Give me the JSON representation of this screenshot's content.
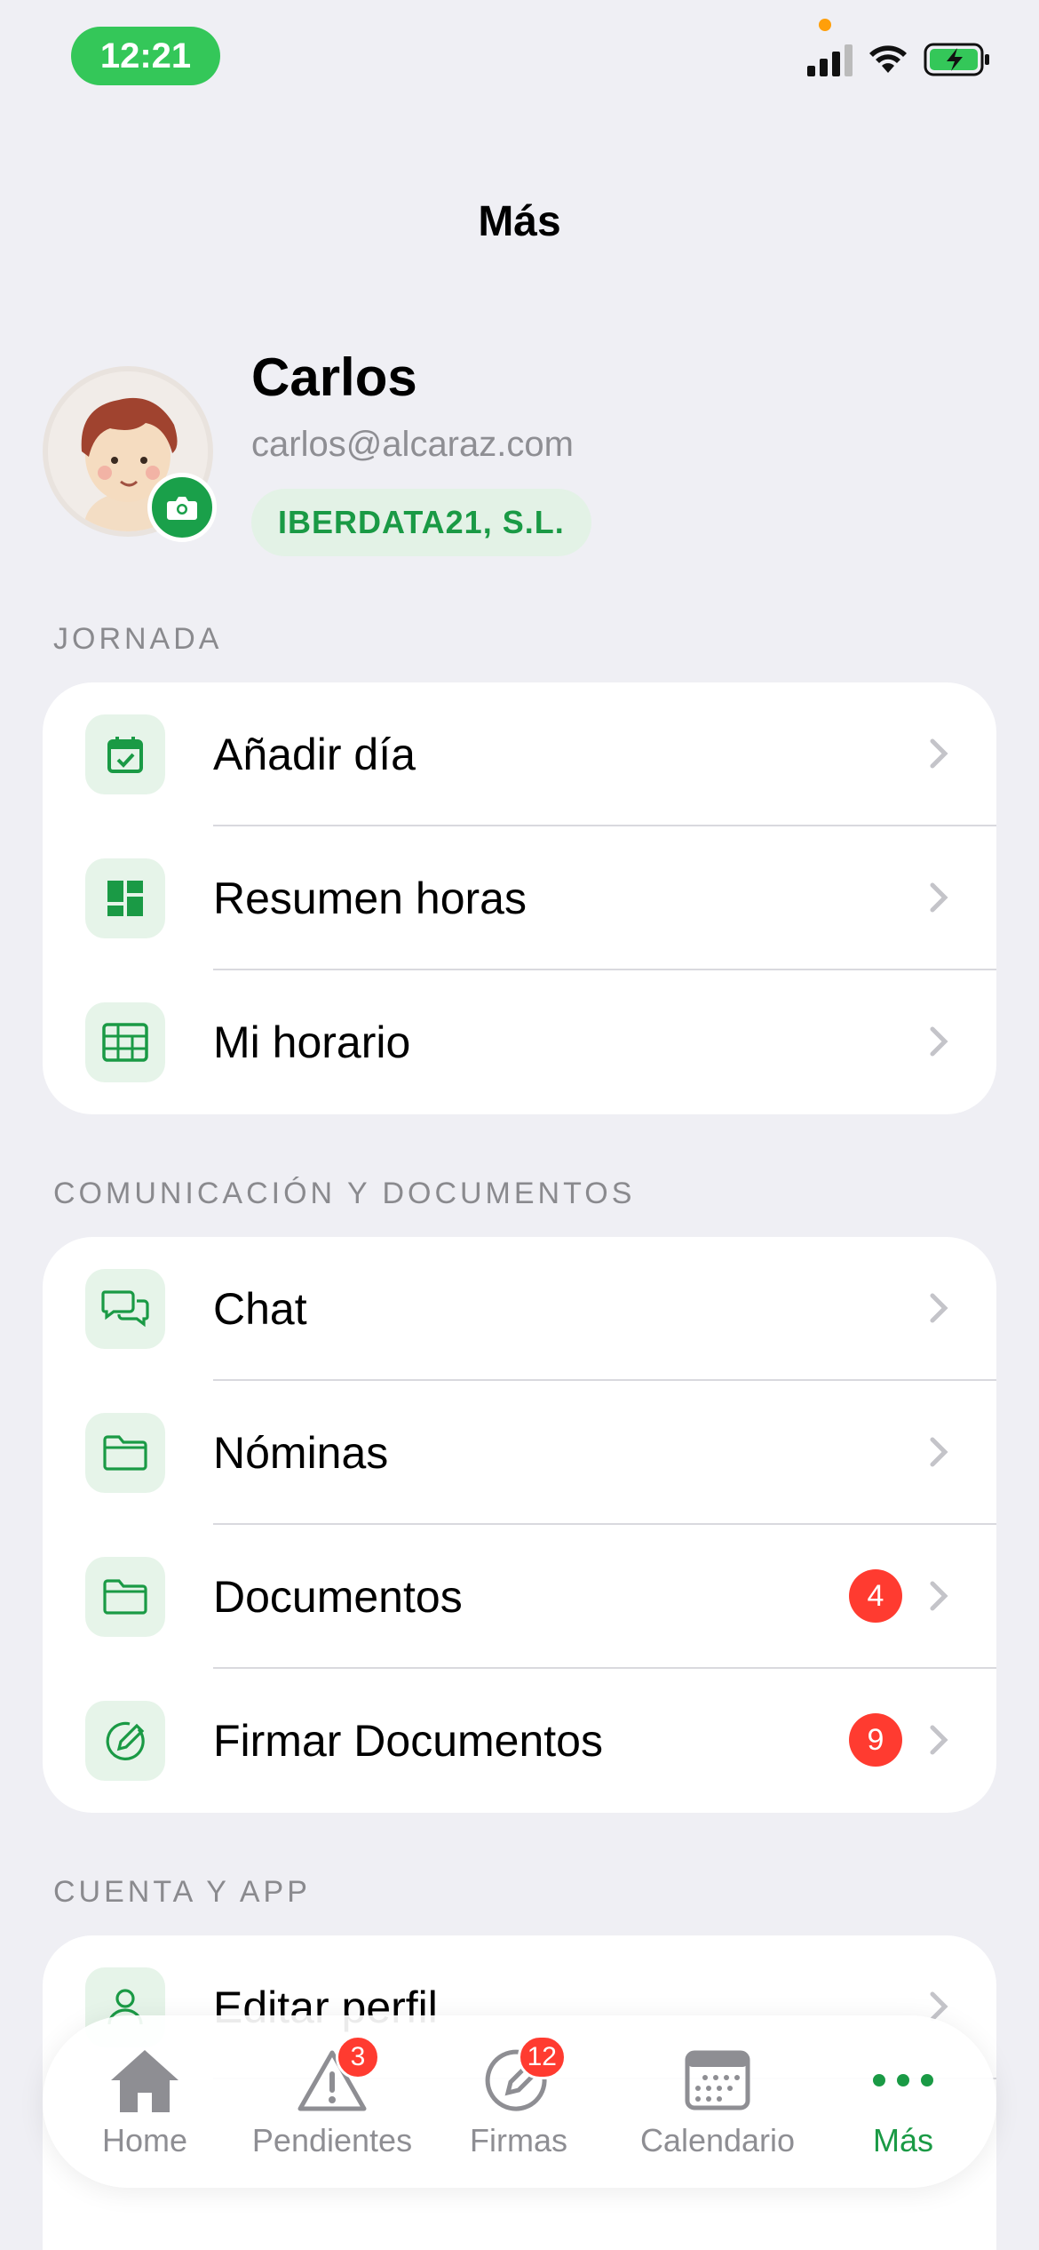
{
  "status_bar": {
    "time": "12:21"
  },
  "nav": {
    "title": "Más"
  },
  "profile": {
    "name": "Carlos",
    "email": "carlos@alcaraz.com",
    "company": "IBERDATA21, S.L."
  },
  "sections": [
    {
      "header": "JORNADA",
      "items": [
        {
          "label": "Añadir día",
          "icon": "calendar-check-icon"
        },
        {
          "label": "Resumen horas",
          "icon": "dashboard-icon"
        },
        {
          "label": "Mi horario",
          "icon": "table-icon"
        }
      ]
    },
    {
      "header": "COMUNICACIÓN Y DOCUMENTOS",
      "items": [
        {
          "label": "Chat",
          "icon": "chat-bubbles-icon"
        },
        {
          "label": "Nóminas",
          "icon": "folder-icon"
        },
        {
          "label": "Documentos",
          "icon": "folder-icon",
          "badge": "4"
        },
        {
          "label": "Firmar Documentos",
          "icon": "signature-icon",
          "badge": "9"
        }
      ]
    },
    {
      "header": "CUENTA Y APP",
      "items": [
        {
          "label": "Editar perfil",
          "icon": "person-icon"
        }
      ]
    }
  ],
  "tabbar": {
    "tabs": [
      {
        "label": "Home",
        "icon": "house-icon"
      },
      {
        "label": "Pendientes",
        "icon": "warning-icon",
        "badge": "3"
      },
      {
        "label": "Firmas",
        "icon": "signature-icon",
        "badge": "12"
      },
      {
        "label": "Calendario",
        "icon": "calendar-icon"
      },
      {
        "label": "Más",
        "icon": "more-dots-icon",
        "active": true
      }
    ]
  },
  "colors": {
    "accent": "#1a9a45",
    "badge": "#ff3b30",
    "background": "#efeff4",
    "icon_bg": "#e6f4e9"
  }
}
